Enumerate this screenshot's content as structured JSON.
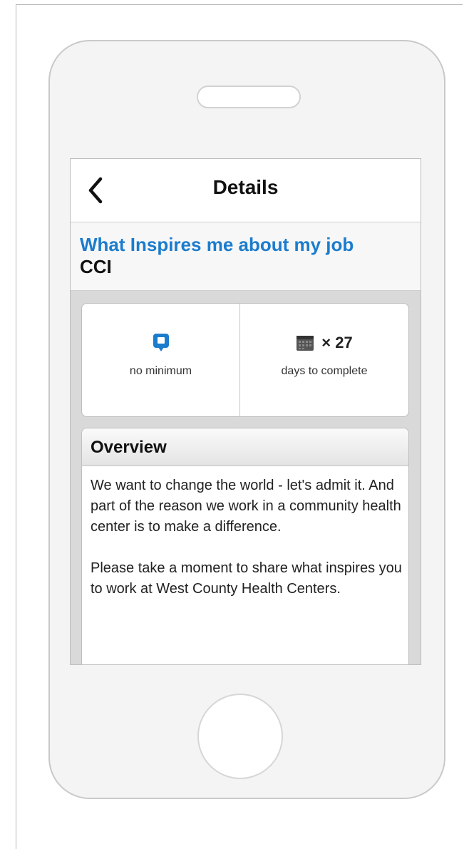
{
  "header": {
    "title": "Details"
  },
  "event": {
    "title": "What Inspires me about my job",
    "subtitle": "CCI"
  },
  "stats": {
    "minimum_label": "no minimum",
    "days_count": "× 27",
    "days_label": "days to complete"
  },
  "overview": {
    "title": "Overview",
    "paragraphs": [
      "We want to change the world - let's admit it. And part of the reason we work in a community health center is to make a difference.",
      "Please take a moment to share what inspires you to work at West County Health Centers."
    ]
  },
  "icons": {
    "back": "chevron-left-icon",
    "minimum": "chat-bubble-icon",
    "days": "calendar-icon"
  },
  "colors": {
    "accent": "#1b7ccd"
  }
}
